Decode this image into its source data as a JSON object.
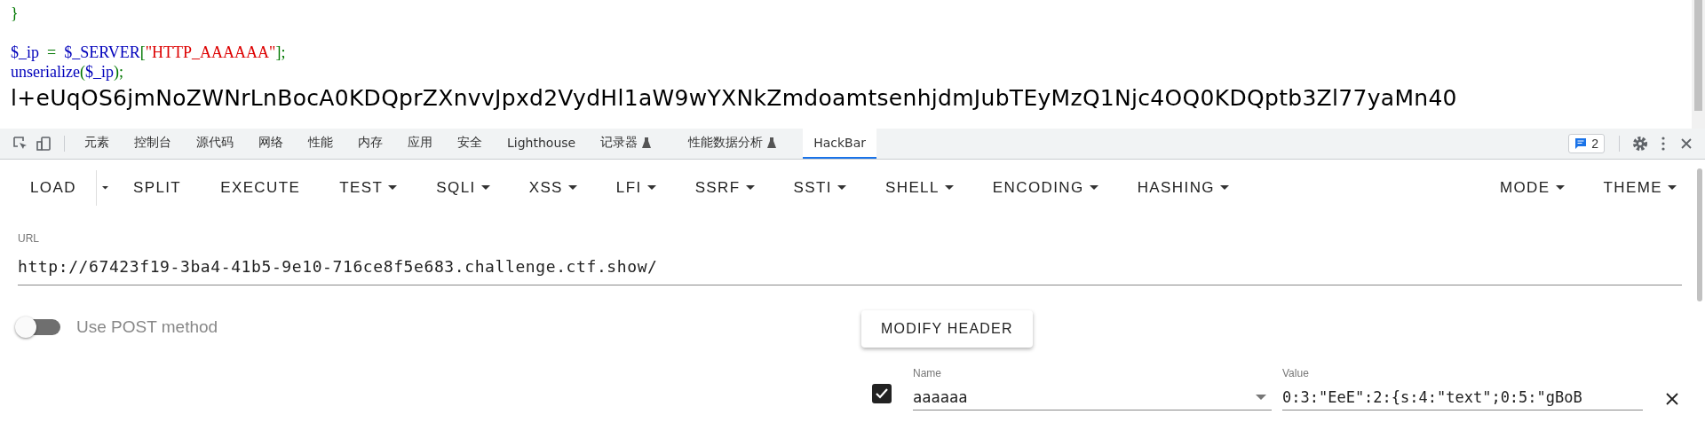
{
  "code_blocks": [
    [
      [
        {
          "kind": "op",
          "text": "}"
        }
      ]
    ],
    [
      [
        {
          "kind": "var",
          "text": "$_ip"
        },
        {
          "kind": "op",
          "text": "  =  "
        },
        {
          "kind": "var",
          "text": "$_SERVER"
        },
        {
          "kind": "op",
          "text": "["
        },
        {
          "kind": "str",
          "text": "\"HTTP_AAAAAA\""
        },
        {
          "kind": "op",
          "text": "];"
        }
      ],
      [
        {
          "kind": "var",
          "text": "unserialize"
        },
        {
          "kind": "op",
          "text": "("
        },
        {
          "kind": "var",
          "text": "$_ip"
        },
        {
          "kind": "op",
          "text": ");"
        }
      ]
    ]
  ],
  "output": "l+eUqOS6jmNoZWNrLnBocA0KDQprZXnvvJpxd2VydHl1aW9wYXNkZmdoamtsenhjdmJubTEyMzQ1Njc4OQ0KDQptb3Zl77yaMn40",
  "devtools": {
    "tabs": [
      {
        "label": "元素",
        "selected": false,
        "experimental": false
      },
      {
        "label": "控制台",
        "selected": false,
        "experimental": false
      },
      {
        "label": "源代码",
        "selected": false,
        "experimental": false
      },
      {
        "label": "网络",
        "selected": false,
        "experimental": false
      },
      {
        "label": "性能",
        "selected": false,
        "experimental": false
      },
      {
        "label": "内存",
        "selected": false,
        "experimental": false
      },
      {
        "label": "应用",
        "selected": false,
        "experimental": false
      },
      {
        "label": "安全",
        "selected": false,
        "experimental": false
      },
      {
        "label": "Lighthouse",
        "selected": false,
        "experimental": false
      },
      {
        "label": "记录器",
        "selected": false,
        "experimental": true
      },
      {
        "label": "性能数据分析",
        "selected": false,
        "experimental": true
      },
      {
        "label": "HackBar",
        "selected": true,
        "experimental": false
      }
    ],
    "issues_count": "2"
  },
  "hackbar": {
    "toolbar": [
      {
        "label": "LOAD",
        "kind": "split"
      },
      {
        "label": "SPLIT",
        "kind": "plain"
      },
      {
        "label": "EXECUTE",
        "kind": "plain"
      },
      {
        "label": "TEST",
        "kind": "menu"
      },
      {
        "label": "SQLI",
        "kind": "menu"
      },
      {
        "label": "XSS",
        "kind": "menu"
      },
      {
        "label": "LFI",
        "kind": "menu"
      },
      {
        "label": "SSRF",
        "kind": "menu"
      },
      {
        "label": "SSTI",
        "kind": "menu"
      },
      {
        "label": "SHELL",
        "kind": "menu"
      },
      {
        "label": "ENCODING",
        "kind": "menu"
      },
      {
        "label": "HASHING",
        "kind": "menu"
      }
    ],
    "toolbar_right": [
      {
        "label": "MODE",
        "kind": "menu"
      },
      {
        "label": "THEME",
        "kind": "menu"
      }
    ],
    "url": {
      "label": "URL",
      "value": "http://67423f19-3ba4-41b5-9e10-716ce8f5e683.challenge.ctf.show/"
    },
    "post_toggle": {
      "label": "Use POST method",
      "on": false
    },
    "modify_header": "MODIFY HEADER",
    "headers": [
      {
        "enabled": true,
        "name_label": "Name",
        "name": "aaaaaa",
        "value_label": "Value",
        "value": "0:3:\"EeE\":2:{s:4:\"text\";0:5:\"gBoB"
      }
    ]
  }
}
